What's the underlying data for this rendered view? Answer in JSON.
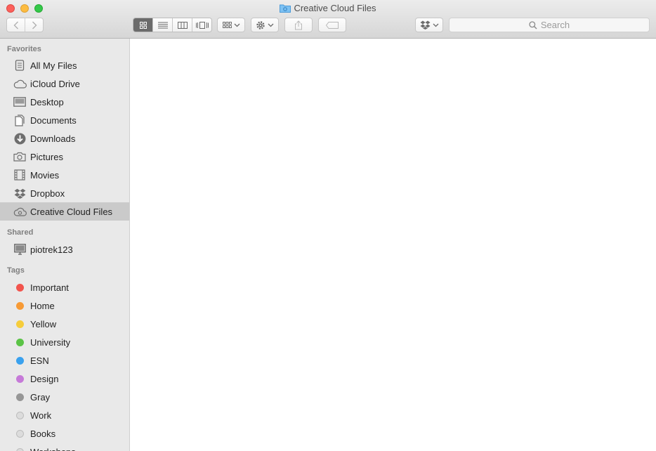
{
  "window": {
    "title": "Creative Cloud Files"
  },
  "toolbar": {
    "view_modes": [
      "icon-view",
      "list-view",
      "column-view",
      "cover-flow-view"
    ],
    "search_placeholder": "Search"
  },
  "sidebar": {
    "favorites_label": "Favorites",
    "favorites": [
      {
        "label": "All My Files",
        "icon": "all-files-icon"
      },
      {
        "label": "iCloud Drive",
        "icon": "cloud-icon"
      },
      {
        "label": "Desktop",
        "icon": "desktop-icon"
      },
      {
        "label": "Documents",
        "icon": "documents-icon"
      },
      {
        "label": "Downloads",
        "icon": "downloads-icon"
      },
      {
        "label": "Pictures",
        "icon": "camera-icon"
      },
      {
        "label": "Movies",
        "icon": "film-icon"
      },
      {
        "label": "Dropbox",
        "icon": "dropbox-icon"
      },
      {
        "label": "Creative Cloud Files",
        "icon": "creative-cloud-icon",
        "selected": true
      }
    ],
    "shared_label": "Shared",
    "shared": [
      {
        "label": "piotrek123",
        "icon": "monitor-icon"
      }
    ],
    "tags_label": "Tags",
    "tags": [
      {
        "label": "Important",
        "color": "#f2544d"
      },
      {
        "label": "Home",
        "color": "#f79a35"
      },
      {
        "label": "Yellow",
        "color": "#f6cd3b"
      },
      {
        "label": "University",
        "color": "#5bc346"
      },
      {
        "label": "ESN",
        "color": "#3aa1ee"
      },
      {
        "label": "Design",
        "color": "#c67ad8"
      },
      {
        "label": "Gray",
        "color": "#969696"
      },
      {
        "label": "Work",
        "color": "#dcdcdc"
      },
      {
        "label": "Books",
        "color": "#dcdcdc"
      },
      {
        "label": "Workshops",
        "color": "#dcdcdc"
      }
    ]
  }
}
